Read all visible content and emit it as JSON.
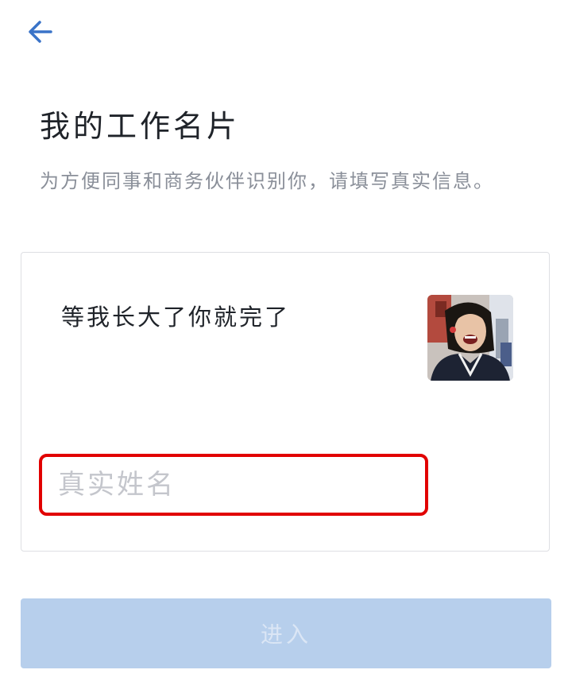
{
  "header": {
    "back_icon": "arrow-left-icon"
  },
  "page": {
    "title": "我的工作名片",
    "subtitle": "为方便同事和商务伙伴识别你，请填写真实信息。"
  },
  "card": {
    "display_name": "等我长大了你就完了",
    "avatar_icon": "avatar-photo",
    "name_input": {
      "value": "",
      "placeholder": "真实姓名"
    }
  },
  "actions": {
    "enter_label": "进入",
    "enter_enabled": false
  },
  "colors": {
    "accent": "#3a73c8",
    "button_disabled_bg": "#b7cfec",
    "highlight_border": "#e10000",
    "title_text": "#1f2329",
    "subtitle_text": "#8a8f99"
  }
}
